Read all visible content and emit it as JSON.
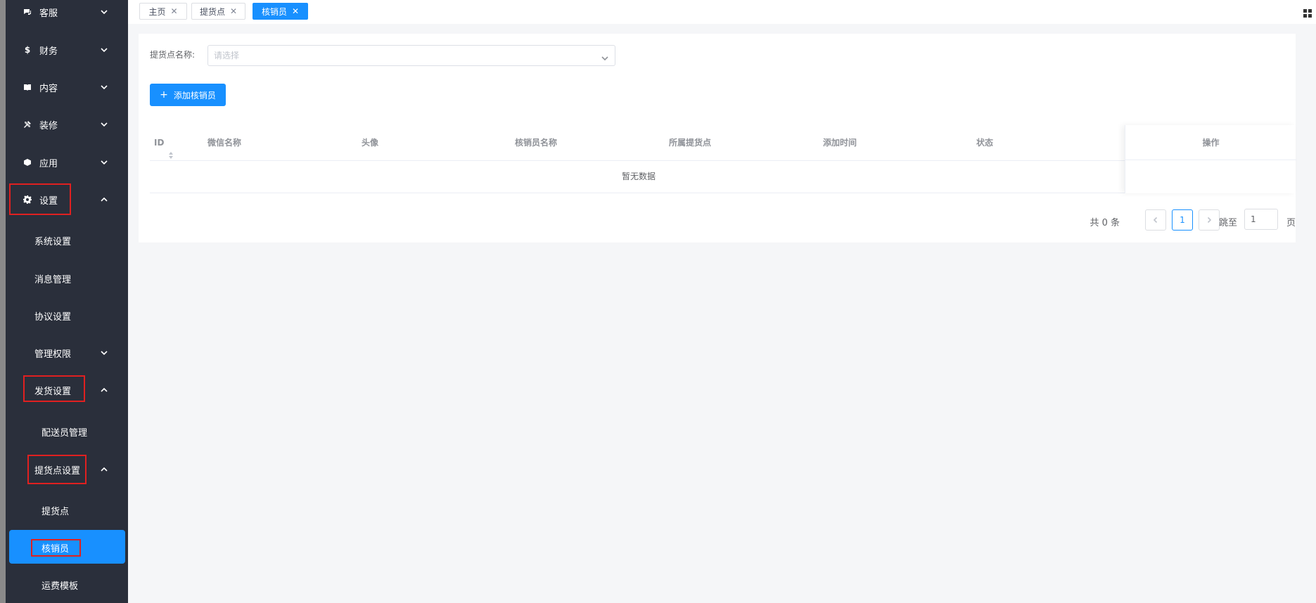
{
  "sidebar": {
    "items": [
      {
        "label": "客服",
        "icon": "chat-icon"
      },
      {
        "label": "财务",
        "icon": "dollar-icon"
      },
      {
        "label": "内容",
        "icon": "book-icon"
      },
      {
        "label": "装修",
        "icon": "tools-icon"
      },
      {
        "label": "应用",
        "icon": "cube-icon"
      },
      {
        "label": "设置",
        "icon": "gear-icon"
      },
      {
        "label": "系统设置"
      },
      {
        "label": "消息管理"
      },
      {
        "label": "协议设置"
      },
      {
        "label": "管理权限"
      },
      {
        "label": "发货设置"
      },
      {
        "label": "配送员管理"
      },
      {
        "label": "提货点设置"
      },
      {
        "label": "提货点"
      },
      {
        "label": "核销员"
      },
      {
        "label": "运费模板"
      }
    ],
    "active_color": "#1890ff",
    "highlight_color": "#e02020"
  },
  "tabs": [
    {
      "label": "主页"
    },
    {
      "label": "提货点"
    },
    {
      "label": "核销员",
      "active": true
    }
  ],
  "filter": {
    "label": "提货点名称:",
    "placeholder": "请选择"
  },
  "add_button": {
    "label": "添加核销员"
  },
  "table": {
    "columns": [
      "ID",
      "微信名称",
      "头像",
      "核销员名称",
      "所属提货点",
      "添加时间",
      "状态",
      "操作"
    ],
    "empty_text": "暂无数据"
  },
  "pagination": {
    "total": "共 0 条",
    "current_page": "1",
    "jump_label": "跳至",
    "jump_value": "1",
    "page_suffix": "页"
  }
}
